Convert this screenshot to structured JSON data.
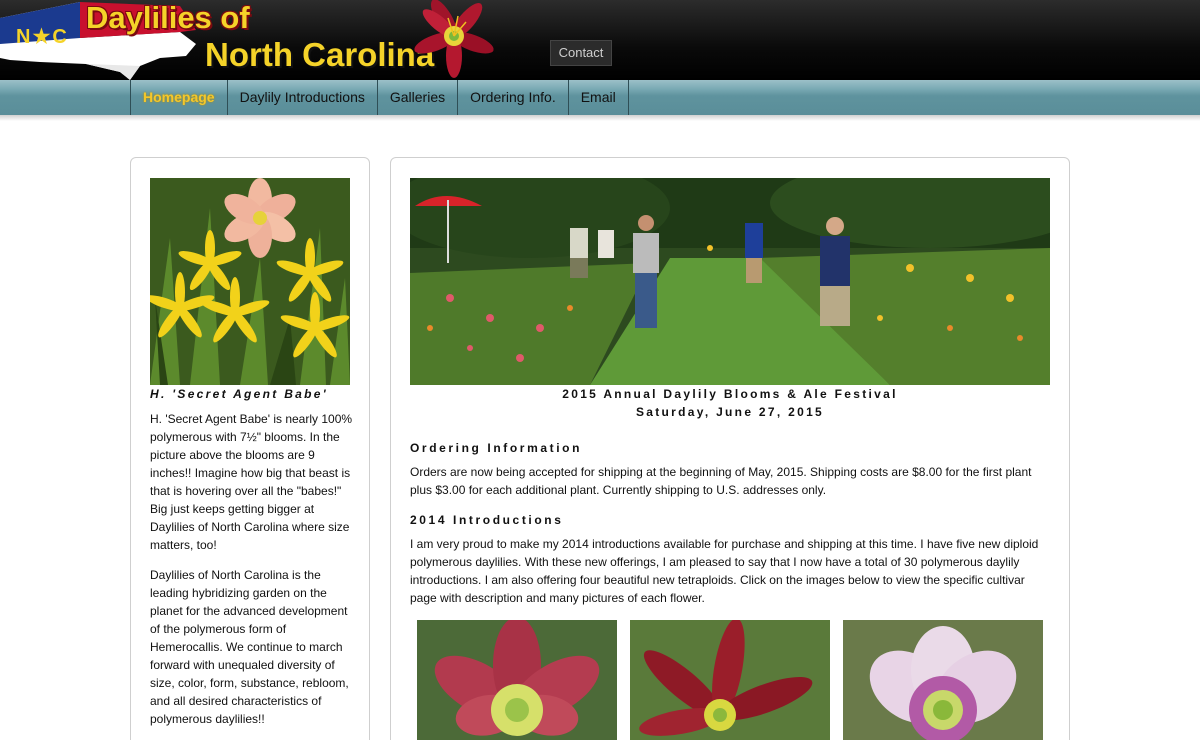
{
  "logo": {
    "nc_letters": "N★C",
    "line1": "Daylilies of",
    "line2": "North Carolina"
  },
  "header": {
    "contact_label": "Contact"
  },
  "nav": {
    "items": [
      {
        "label": "Homepage"
      },
      {
        "label": "Daylily Introductions"
      },
      {
        "label": "Galleries"
      },
      {
        "label": "Ordering Info."
      },
      {
        "label": "Email"
      }
    ]
  },
  "sidebar": {
    "photo_caption": "H. 'Secret Agent Babe'",
    "para1": "H. 'Secret Agent Babe' is nearly 100% polymerous with 7½\" blooms. In the picture above the blooms are 9 inches!! Imagine how big that beast is that is hovering over all the \"babes!\" Big just keeps getting bigger at Daylilies of North Carolina where size matters, too!",
    "para2": "Daylilies of North Carolina is the leading hybridizing garden on the planet for the advanced development of the polymerous form of Hemerocallis. We continue to march forward with unequaled diversity of size, color, form, substance, rebloom, and all desired characteristics of polymerous daylilies!!"
  },
  "main": {
    "hero_caption_line1": "2015 Annual Daylily Blooms & Ale Festival",
    "hero_caption_line2": "Saturday, June 27, 2015",
    "ordering_title": "Ordering Information",
    "ordering_text": "Orders are now being accepted for shipping at the beginning of May, 2015. Shipping costs are $8.00 for the first plant plus $3.00 for each additional plant. Currently shipping to U.S. addresses only.",
    "intro_title": "2014 Introductions",
    "intro_text": "I am very proud to make my 2014 introductions available for purchase and shipping at this time. I have five new diploid polymerous daylilies. With these new offerings, I am pleased to say that I now have a total of 30 polymerous daylily introductions. I am also offering four beautiful new tetraploids. Click on the images below to view the specific cultivar page with description and many pictures of each flower."
  },
  "colors": {
    "logo_yellow": "#f5d329",
    "nav_active": "#f5c72a",
    "nav_bar": "#5f939e"
  }
}
